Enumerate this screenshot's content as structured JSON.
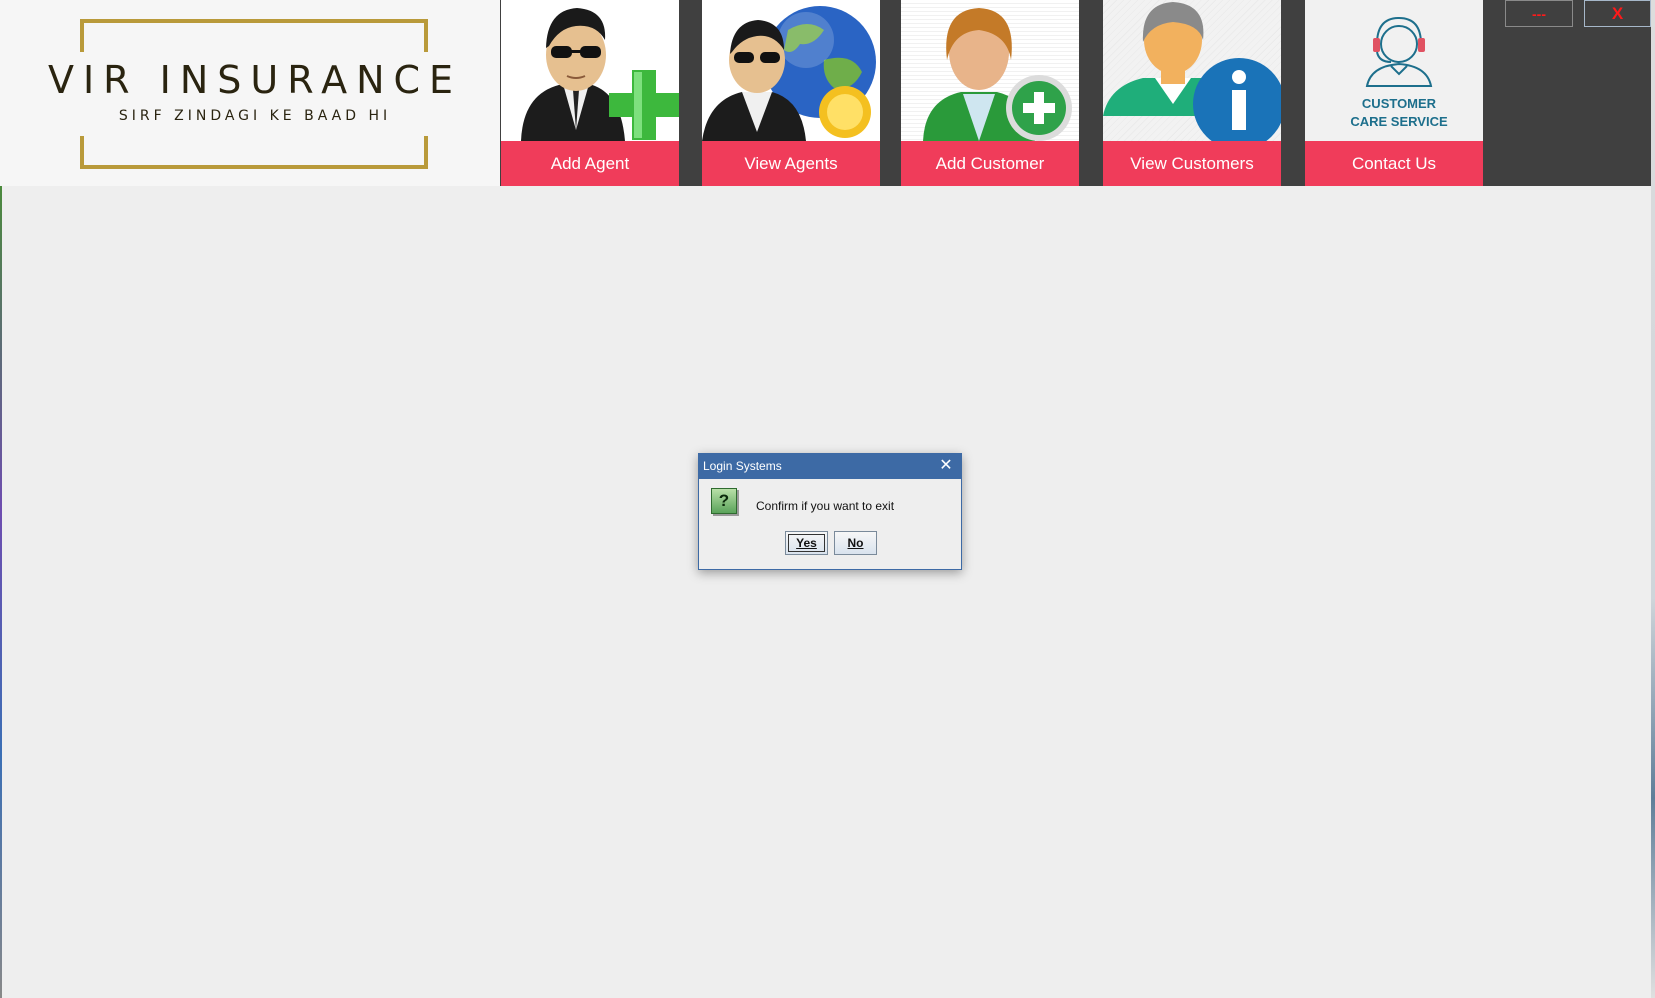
{
  "brand": {
    "title": "VIR INSURANCE",
    "tagline": "SIRF ZINDAGI KE BAAD HI",
    "gold": "#b99a3a"
  },
  "nav": [
    {
      "label": "Add Agent",
      "icon": "agent-add-icon"
    },
    {
      "label": "View Agents",
      "icon": "agent-globe-icon"
    },
    {
      "label": "Add Customer",
      "icon": "customer-add-icon"
    },
    {
      "label": "View Customers",
      "icon": "customer-info-icon"
    },
    {
      "label": "Contact Us",
      "icon": "customer-care-icon",
      "icon_text": [
        "CUSTOMER",
        "CARE SERVICE"
      ]
    }
  ],
  "window_controls": {
    "minimize": "---",
    "close": "X"
  },
  "dialog": {
    "title": "Login Systems",
    "close": "✕",
    "message": "Confirm if you want to exit",
    "icon": "?",
    "yes_label": "Yes",
    "no_label": "No"
  },
  "colors": {
    "nav_label_bg": "#f03c5a",
    "topbar_bg": "#404040",
    "dialog_title_bg": "#3d6aa5"
  }
}
